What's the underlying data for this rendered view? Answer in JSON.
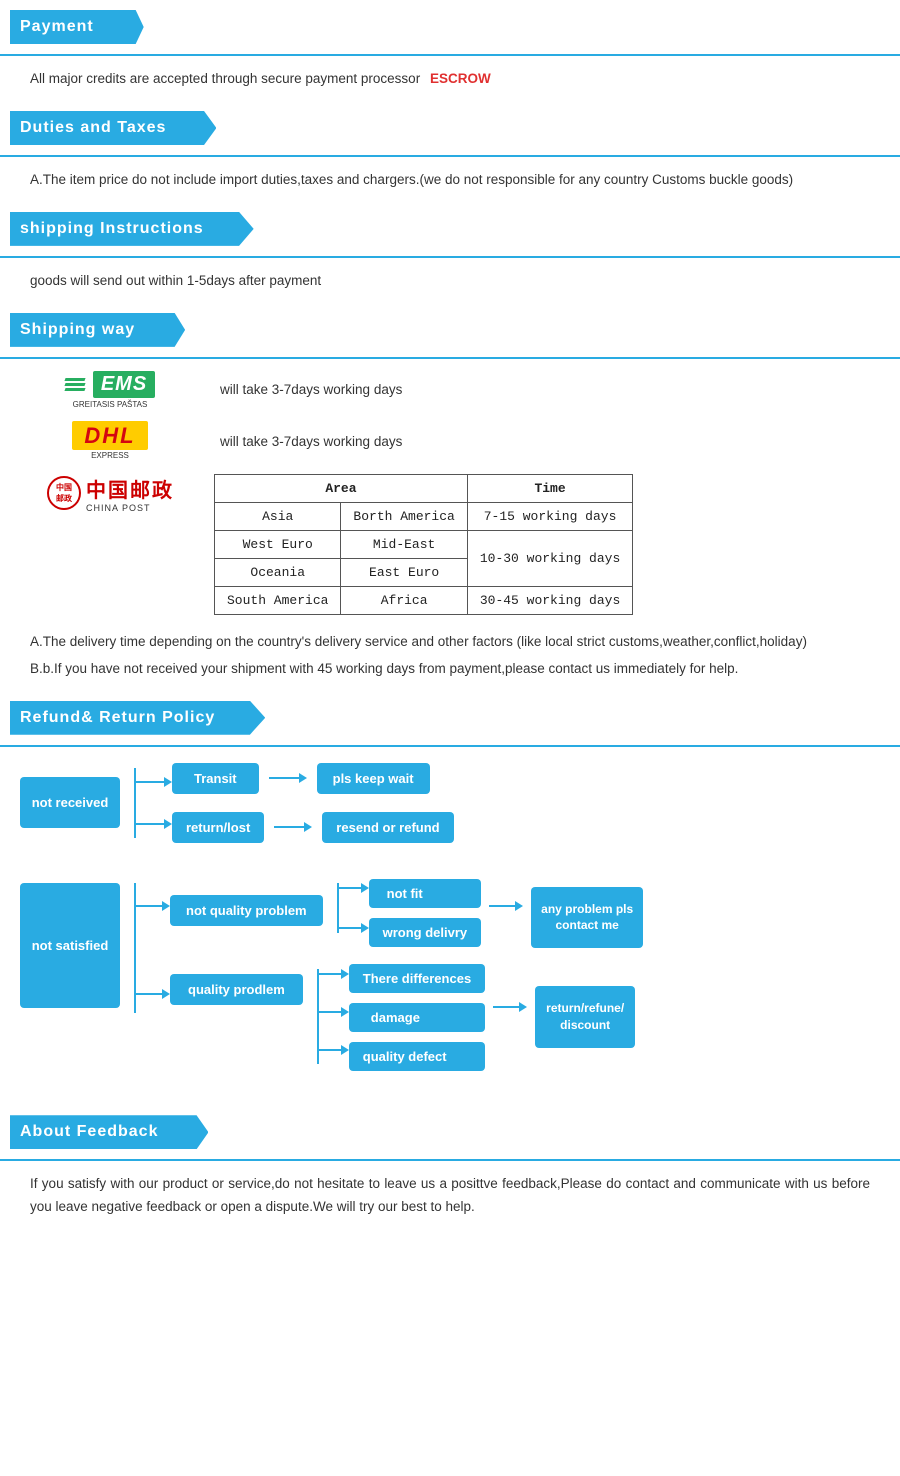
{
  "payment": {
    "header": "Payment",
    "text": "All  major  credits  are  accepted  through  secure  payment  processor",
    "highlight": "ESCROW"
  },
  "duties": {
    "header": "Duties  and  Taxes",
    "text": "A.The  item  price  do  not  include  import  duties,taxes  and  chargers.(we  do  not  responsible  for  any  country  Customs  buckle  goods)"
  },
  "shipping_instructions": {
    "header": "shipping  Instructions",
    "text": "goods  will  send  out  within  1-5days  after  payment"
  },
  "shipping_way": {
    "header": "Shipping  way",
    "ems_label": "EMS",
    "ems_sub": "GREITASIS PAŠTAS",
    "ems_days": "will  take  3-7days  working  days",
    "dhl_label": "DHL",
    "dhl_sub": "EXPRESS",
    "dhl_days": "will  take  3-7days  working  days",
    "chinapost_label": "中国邮政",
    "chinapost_sub": "CHINA POST",
    "table": {
      "col1": "Area",
      "col2": "",
      "col3": "Time",
      "rows": [
        {
          "area1": "Asia",
          "area2": "Borth America",
          "time": "7-15 working days"
        },
        {
          "area1": "West Euro",
          "area2": "Mid-East",
          "time": "10-30 working days"
        },
        {
          "area1": "Oceania",
          "area2": "East Euro",
          "time": ""
        },
        {
          "area1": "South America",
          "area2": "Africa",
          "time": "30-45 working days"
        }
      ]
    },
    "note_a": "A.The  delivery  time  depending  on  the  country's  delivery  service  and  other  factors  (like  local  strict  customs,weather,conflict,holiday)",
    "note_b": "B.b.If  you  have  not  received  your  shipment  with  45  working  days  from  payment,please  contact  us  immediately  for  help."
  },
  "refund": {
    "header": "Refund&  Return  Policy",
    "not_received": "not  received",
    "transit": "Transit",
    "return_lost": "return/lost",
    "pls_keep_wait": "pls  keep  wait",
    "resend_or_refund": "resend  or  refund",
    "not_satisfied": "not  satisfied",
    "not_quality_problem": "not  quality  problem",
    "not_fit": "not  fit",
    "wrong_delivery": "wrong  delivry",
    "there_differences": "There  differences",
    "quality_prodlem": "quality  prodlem",
    "damage": "damage",
    "quality_defect": "quality  defect",
    "any_problem": "any  problem  pls\ncontact  me",
    "return_refune_discount": "return/refune/\ndiscount"
  },
  "feedback": {
    "header": "About  Feedback",
    "text": "If  you  satisfy  with  our  product  or  service,do  not  hesitate  to  leave  us  a  posittve  feedback,Please  do  contact  and  communicate  with  us  before  you  leave  negative  feedback  or  open  a  dispute.We  will  try  our  best  to  help."
  }
}
